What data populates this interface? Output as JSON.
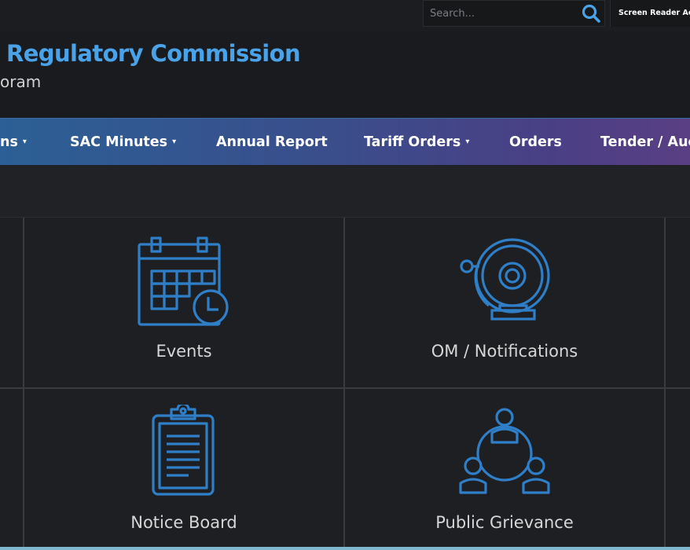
{
  "topbar": {
    "search_placeholder": "Search...",
    "search_icon": "search-icon",
    "screen_reader_label": "Screen Reader Access"
  },
  "header": {
    "title": "Regulatory Commission",
    "subtitle": "oram"
  },
  "nav": {
    "items": [
      {
        "label": "ns",
        "dropdown": true
      },
      {
        "label": "SAC Minutes",
        "dropdown": true
      },
      {
        "label": "Annual Report",
        "dropdown": false
      },
      {
        "label": "Tariff Orders",
        "dropdown": true
      },
      {
        "label": "Orders",
        "dropdown": false
      },
      {
        "label": "Tender / Auc",
        "dropdown": false
      }
    ],
    "caret_glyph": "▾"
  },
  "tiles": [
    {
      "label": "Events",
      "icon": "calendar-clock-icon"
    },
    {
      "label": "OM / Notifications",
      "icon": "bell-icon"
    },
    {
      "label": "Notice Board",
      "icon": "clipboard-icon"
    },
    {
      "label": "Public Grievance",
      "icon": "people-network-icon"
    }
  ],
  "colors": {
    "accent": "#4aa3e8",
    "icon_blue": "#2f7fc8",
    "nav_start": "#2c5f95",
    "nav_end": "#5a3f83"
  }
}
